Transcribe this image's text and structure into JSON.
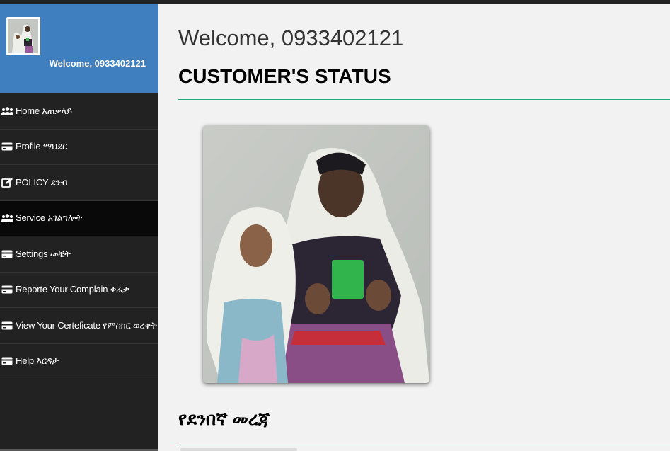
{
  "sidebar": {
    "welcome": "Welcome, 0933402121",
    "items": [
      {
        "label": "Home አጠቃላይ",
        "icon": "users-icon"
      },
      {
        "label": "Profile ማህደር",
        "icon": "card-icon"
      },
      {
        "label": "POLICY ደንብ",
        "icon": "edit-icon"
      },
      {
        "label": "Service አገልግሎት",
        "icon": "users-icon"
      },
      {
        "label": "Settings መቼት",
        "icon": "card-icon"
      },
      {
        "label": "Reporte Your Complain ቅሬታ",
        "icon": "card-icon"
      },
      {
        "label": "View Your Certeficate የምስክር ወረቀት",
        "icon": "card-icon"
      },
      {
        "label": "Help እርዳታ",
        "icon": "card-icon"
      }
    ],
    "active_index": 3
  },
  "main": {
    "welcome": "Welcome, 0933402121",
    "status_title": "CUSTOMER'S STATUS",
    "section_title": "የደንበኛ መረጃ"
  },
  "colors": {
    "sidebar_header": "#3f7fbf",
    "sidebar_bg": "#222222",
    "accent_line": "#1faa77",
    "page_bg": "#f2f2f2"
  }
}
